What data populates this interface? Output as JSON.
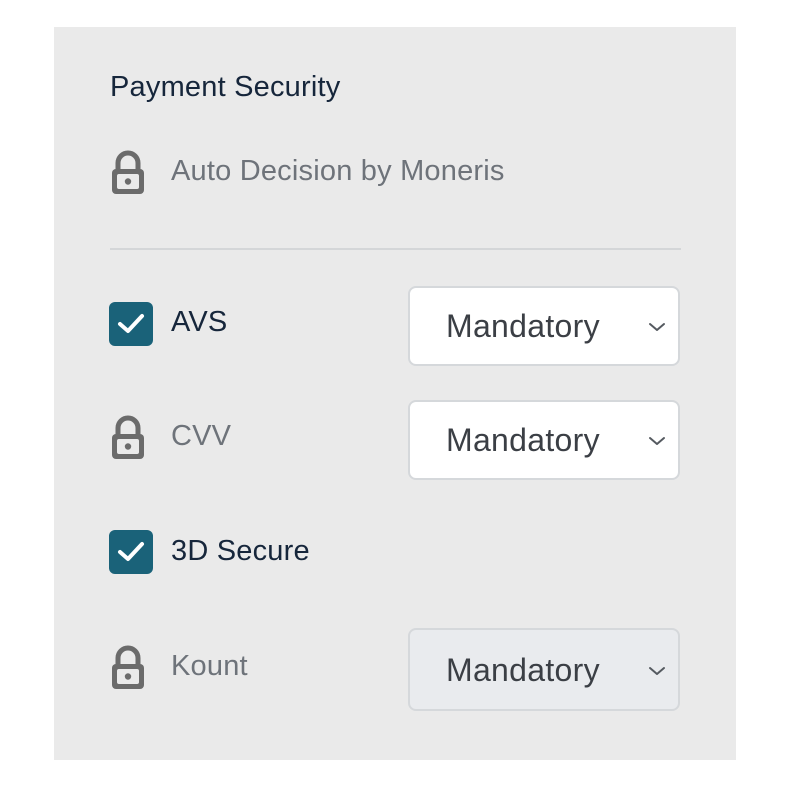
{
  "section": {
    "title": "Payment Security",
    "auto_decision": {
      "icon": "lock-icon",
      "label": "Auto Decision by Moneris"
    }
  },
  "rows": [
    {
      "label": "AVS",
      "control": "checkbox",
      "checked": true,
      "select_value": "Mandatory"
    },
    {
      "label": "CVV",
      "control": "lock-icon",
      "select_value": "Mandatory"
    },
    {
      "label": "3D Secure",
      "control": "checkbox",
      "checked": true
    },
    {
      "label": "Kount",
      "control": "lock-icon",
      "select_value": "Mandatory",
      "select_disabled": true
    }
  ],
  "colors": {
    "accent": "#1a6279",
    "panel_background": "#eaeaea",
    "title_text": "#16263b",
    "muted_text": "#6e737a",
    "disabled_select": "#e9ebee"
  }
}
